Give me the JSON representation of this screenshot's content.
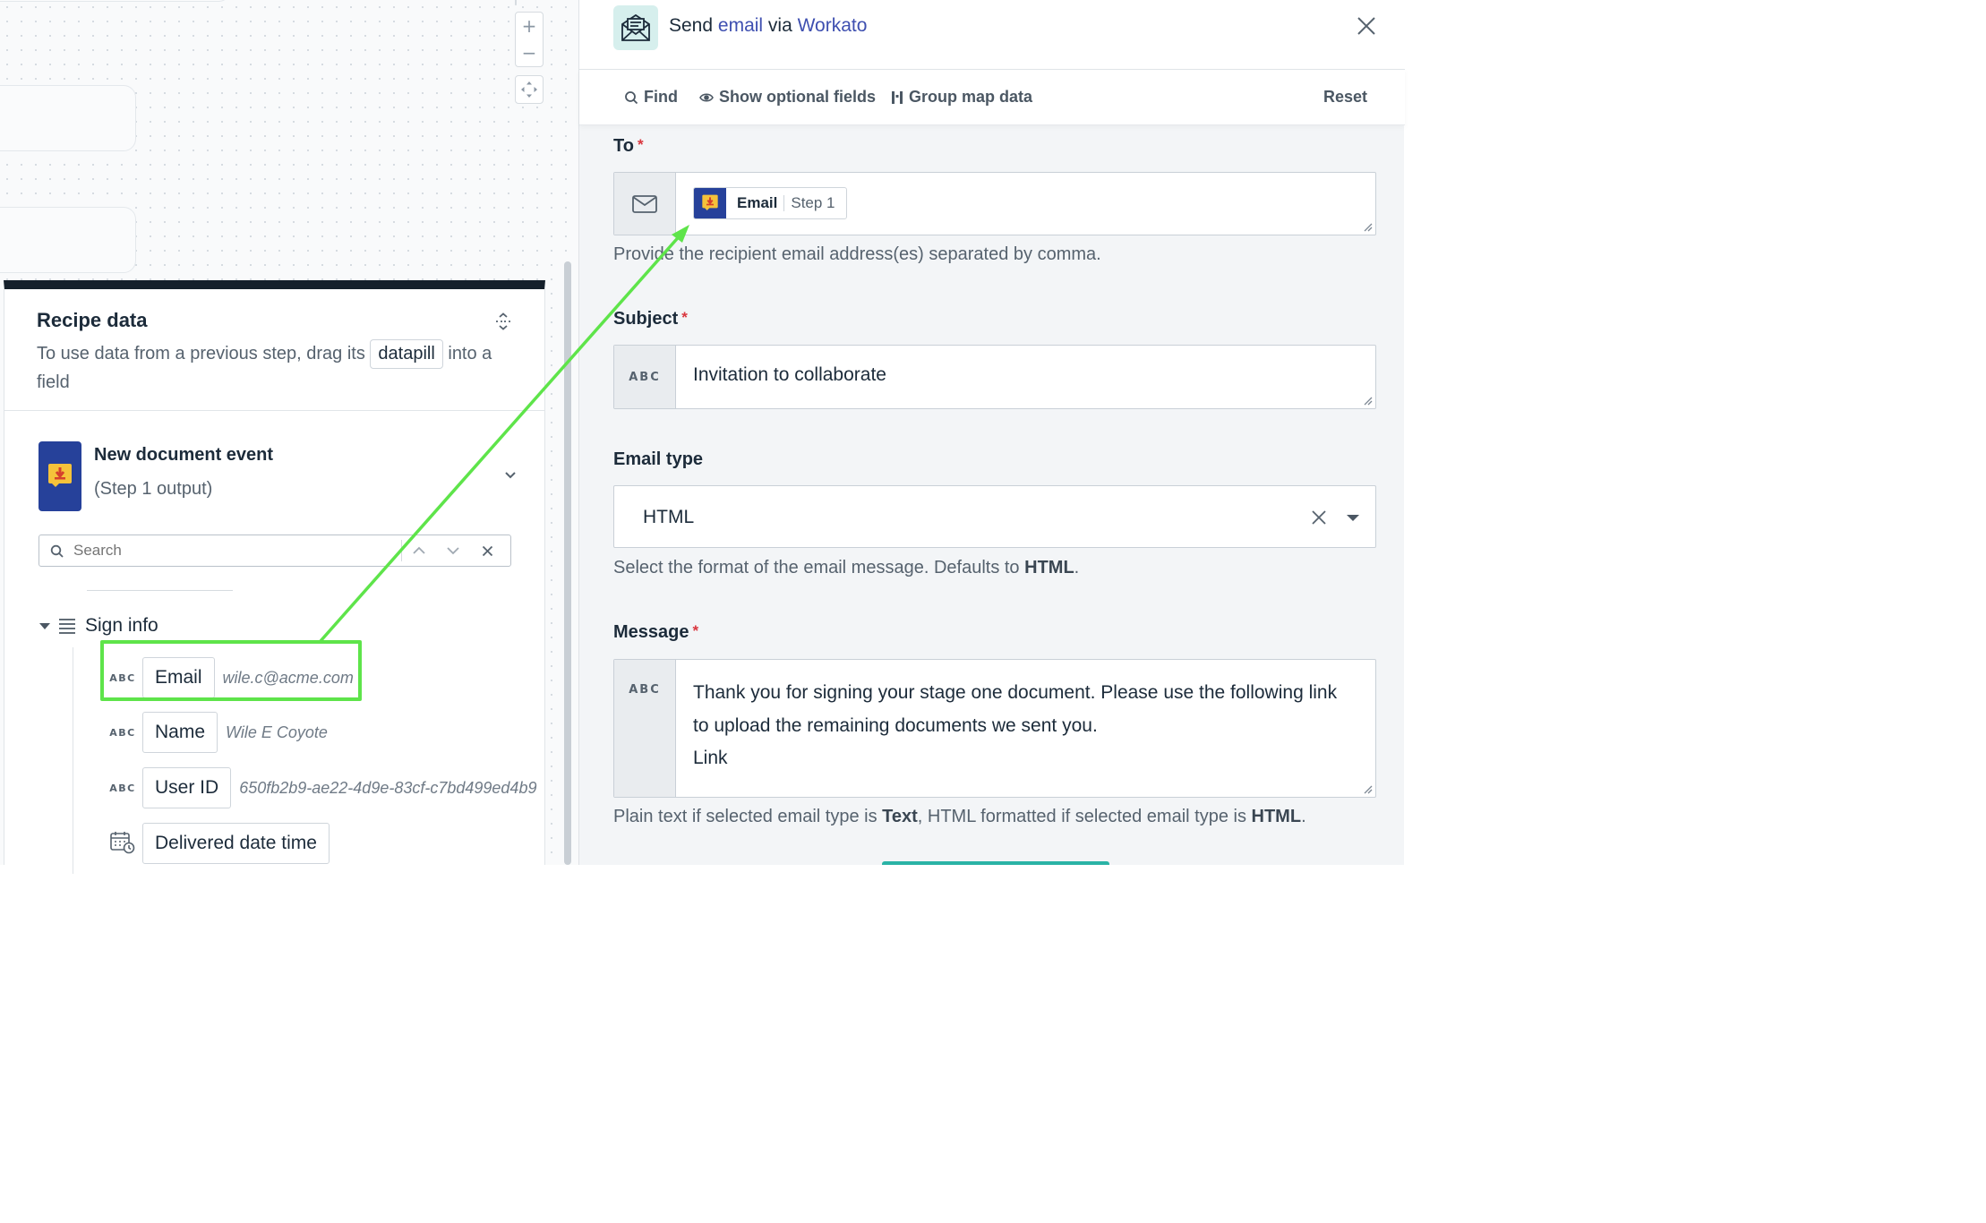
{
  "canvas": {
    "zoom_in": "+",
    "zoom_out": "−"
  },
  "recipe_data": {
    "title": "Recipe data",
    "desc_before": "To use data from a previous step, drag its ",
    "desc_pill": "datapill",
    "desc_after": " into a field",
    "step": {
      "title": "New document event",
      "subtitle": "(Step 1 output)"
    },
    "search": {
      "placeholder": "Search"
    },
    "group": {
      "label": "Sign info"
    },
    "fields": [
      {
        "type": "ABC",
        "name": "Email",
        "sample": "wile.c@acme.com"
      },
      {
        "type": "ABC",
        "name": "Name",
        "sample": "Wile E Coyote"
      },
      {
        "type": "ABC",
        "name": "User ID",
        "sample": "650fb2b9-ae22-4d9e-83cf-c7bd499ed4b9"
      },
      {
        "type": "calendar-icon",
        "name": "Delivered date time",
        "sample": ""
      }
    ]
  },
  "drawer": {
    "title_send": "Send ",
    "title_email": "email",
    "title_via": " via ",
    "title_app": "Workato",
    "toolbar": {
      "find": "Find",
      "show_optional": "Show optional fields",
      "group_map": "Group map data",
      "reset": "Reset"
    },
    "to": {
      "label": "To",
      "required": "*",
      "pill_name": "Email",
      "pill_step": "Step 1",
      "hint": "Provide the recipient email address(es) separated by comma."
    },
    "subject": {
      "label": "Subject",
      "required": "*",
      "type": "ABC",
      "value": "Invitation to collaborate"
    },
    "email_type": {
      "label": "Email type",
      "value": "HTML",
      "hint_before": "Select the format of the email message. Defaults to ",
      "hint_bold": "HTML",
      "hint_after": "."
    },
    "message": {
      "label": "Message",
      "required": "*",
      "type": "ABC",
      "value": "Thank you for signing your stage one document. Please use the following link to upload the remaining documents we sent you.",
      "link_line": "Link",
      "hint_1": "Plain text if selected email type is ",
      "hint_b1": "Text",
      "hint_2": ", HTML formatted if selected email type is ",
      "hint_b2": "HTML",
      "hint_3": "."
    }
  },
  "colors": {
    "accent_link": "#3e4fb0",
    "datapill_brand": "#26419a",
    "drag_highlight": "#5ee44a",
    "required": "#d9363e",
    "teal_button": "#2ab3a6"
  }
}
